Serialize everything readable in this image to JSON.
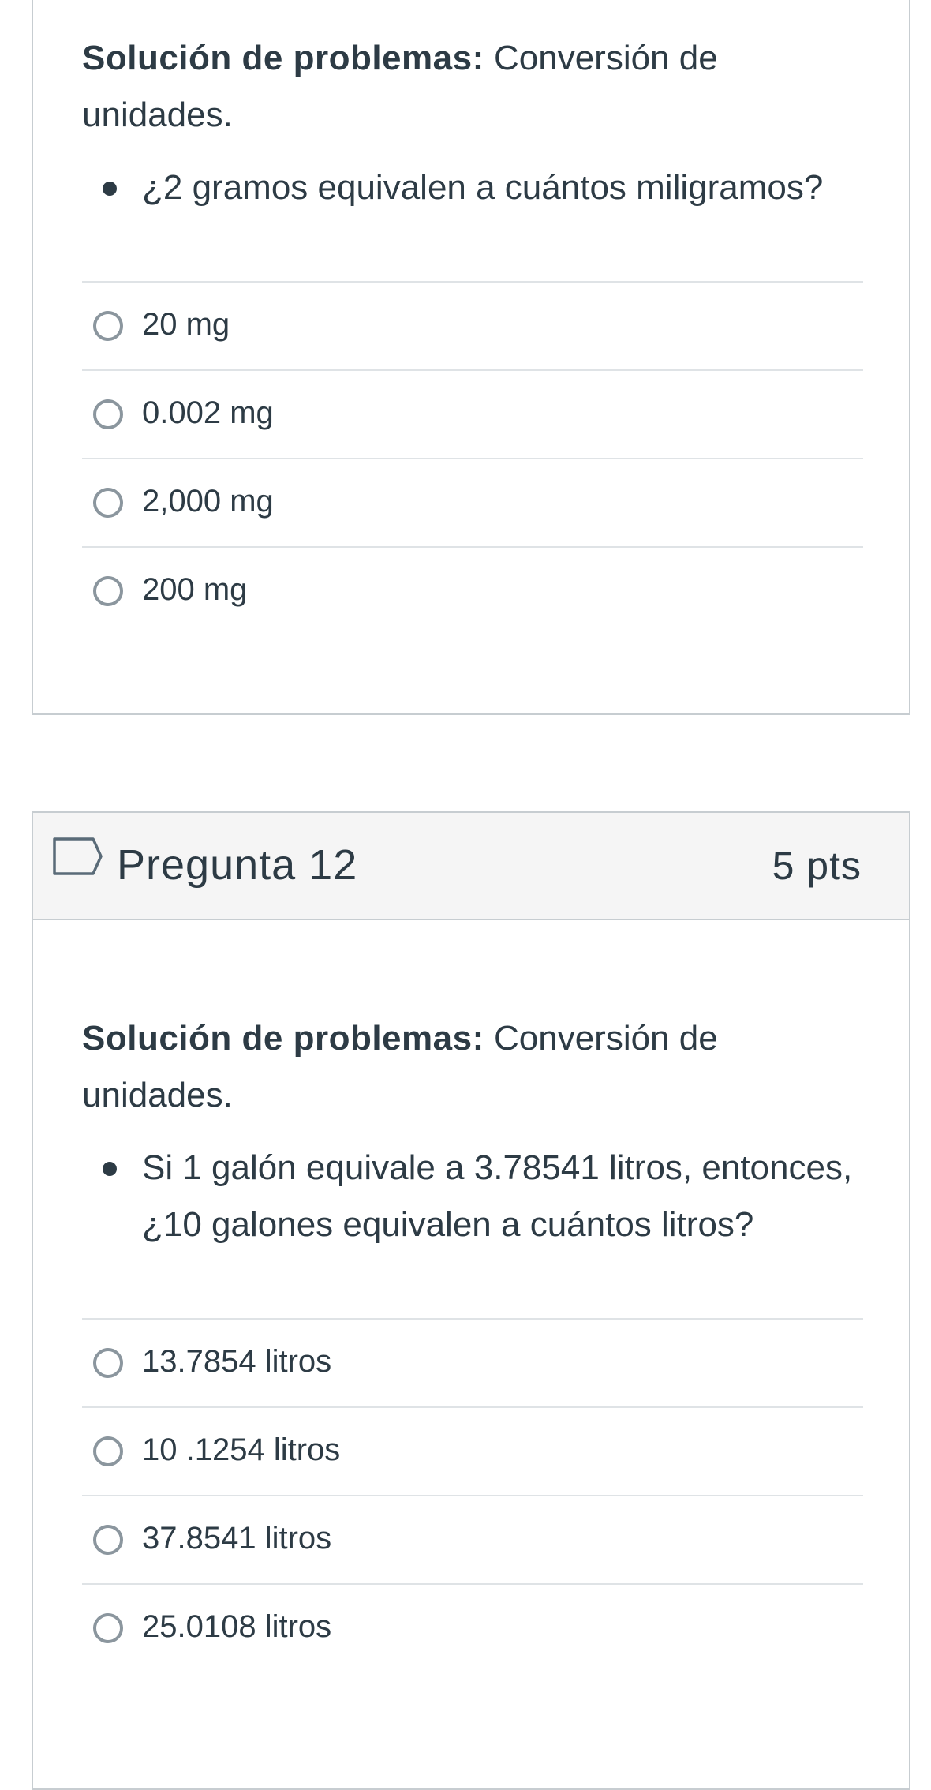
{
  "question11": {
    "prompt_bold": "Solución de problemas:",
    "prompt_rest": " Conversión de unidades.",
    "bullet": "¿2 gramos equivalen a cuántos miligramos?",
    "answers": [
      "20 mg",
      "0.002 mg",
      "2,000 mg",
      "200 mg"
    ]
  },
  "question12": {
    "title": "Pregunta 12",
    "points": "5 pts",
    "prompt_bold": "Solución de problemas:",
    "prompt_rest": " Conversión de unidades.",
    "bullet": "Si 1 galón equivale a 3.78541 litros, entonces, ¿10 galones equivalen a cuántos litros?",
    "answers": [
      "13.7854 litros",
      "10 .1254 litros",
      "37.8541 litros",
      "25.0108 litros"
    ]
  },
  "icons": {
    "flag": "flag-outline-icon",
    "radio": "radio-unchecked-icon",
    "bullet": "bullet-dot-icon"
  },
  "colors": {
    "text": "#2d3b45",
    "border": "#c7cdd1",
    "header_bg": "#f5f5f5",
    "divider": "#dfe3e6",
    "radio_border": "#8b969e"
  }
}
